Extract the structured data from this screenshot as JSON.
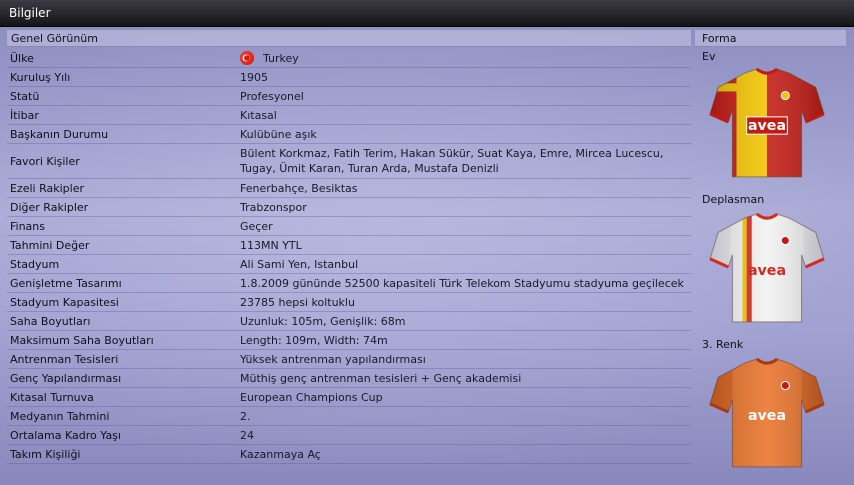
{
  "window": {
    "title": "Bilgiler"
  },
  "overview": {
    "header": "Genel Görünüm",
    "rows": [
      {
        "label": "Ülke",
        "value": "Turkey",
        "icon": "turkey-flag-icon"
      },
      {
        "label": "Kuruluş Yılı",
        "value": "1905"
      },
      {
        "label": "Statü",
        "value": "Profesyonel"
      },
      {
        "label": "İtibar",
        "value": "Kıtasal"
      },
      {
        "label": "Başkanın Durumu",
        "value": "Kulübüne aşık"
      },
      {
        "label": "Favori Kişiler",
        "value": "Bülent Korkmaz, Fatih Terim, Hakan Sükür, Suat Kaya, Emre, Mircea Lucescu, Tugay, Ümit Karan, Turan Arda, Mustafa Denizli"
      },
      {
        "label": "Ezeli Rakipler",
        "value": "Fenerbahçe, Besiktas"
      },
      {
        "label": "Diğer Rakipler",
        "value": "Trabzonspor"
      },
      {
        "label": "Finans",
        "value": "Geçer"
      },
      {
        "label": "Tahmini Değer",
        "value": "113MN YTL"
      },
      {
        "label": "Stadyum",
        "value": "Ali Sami Yen, Istanbul"
      },
      {
        "label": "Genişletme Tasarımı",
        "value": "1.8.2009 gününde 52500 kapasiteli Türk Telekom Stadyumu stadyuma geçilecek"
      },
      {
        "label": "Stadyum Kapasitesi",
        "value": "23785 hepsi koltuklu"
      },
      {
        "label": "Saha Boyutları",
        "value": "Uzunluk: 105m, Genişlik: 68m"
      },
      {
        "label": "Maksimum Saha Boyutları",
        "value": "Length: 109m, Width: 74m"
      },
      {
        "label": "Antrenman Tesisleri",
        "value": "Yüksek antrenman yapılandırması"
      },
      {
        "label": "Genç Yapılandırması",
        "value": "Müthiş genç antrenman tesisleri + Genç akademisi"
      },
      {
        "label": "Kıtasal Turnuva",
        "value": "European Champions Cup"
      },
      {
        "label": "Medyanın Tahmini",
        "value": "2."
      },
      {
        "label": "Ortalama Kadro Yaşı",
        "value": "24"
      },
      {
        "label": "Takım Kişiliği",
        "value": "Kazanmaya Aç"
      }
    ]
  },
  "kits": {
    "header": "Forma",
    "sponsor": "avea",
    "items": [
      {
        "label": "Ev",
        "icon": "home-kit-icon",
        "primary": "#f2c400",
        "secondary": "#c41a14",
        "trim": "#c41a14",
        "text": "#ffffff"
      },
      {
        "label": "Deplasman",
        "icon": "away-kit-icon",
        "primary": "#f2f2f2",
        "secondary": "#d42a1e",
        "trim": "#d42a1e",
        "text": "#d42a1e"
      },
      {
        "label": "3. Renk",
        "icon": "third-kit-icon",
        "primary": "#e8722a",
        "secondary": "#d8621e",
        "trim": "#a83a10",
        "text": "#ffffff"
      }
    ]
  }
}
